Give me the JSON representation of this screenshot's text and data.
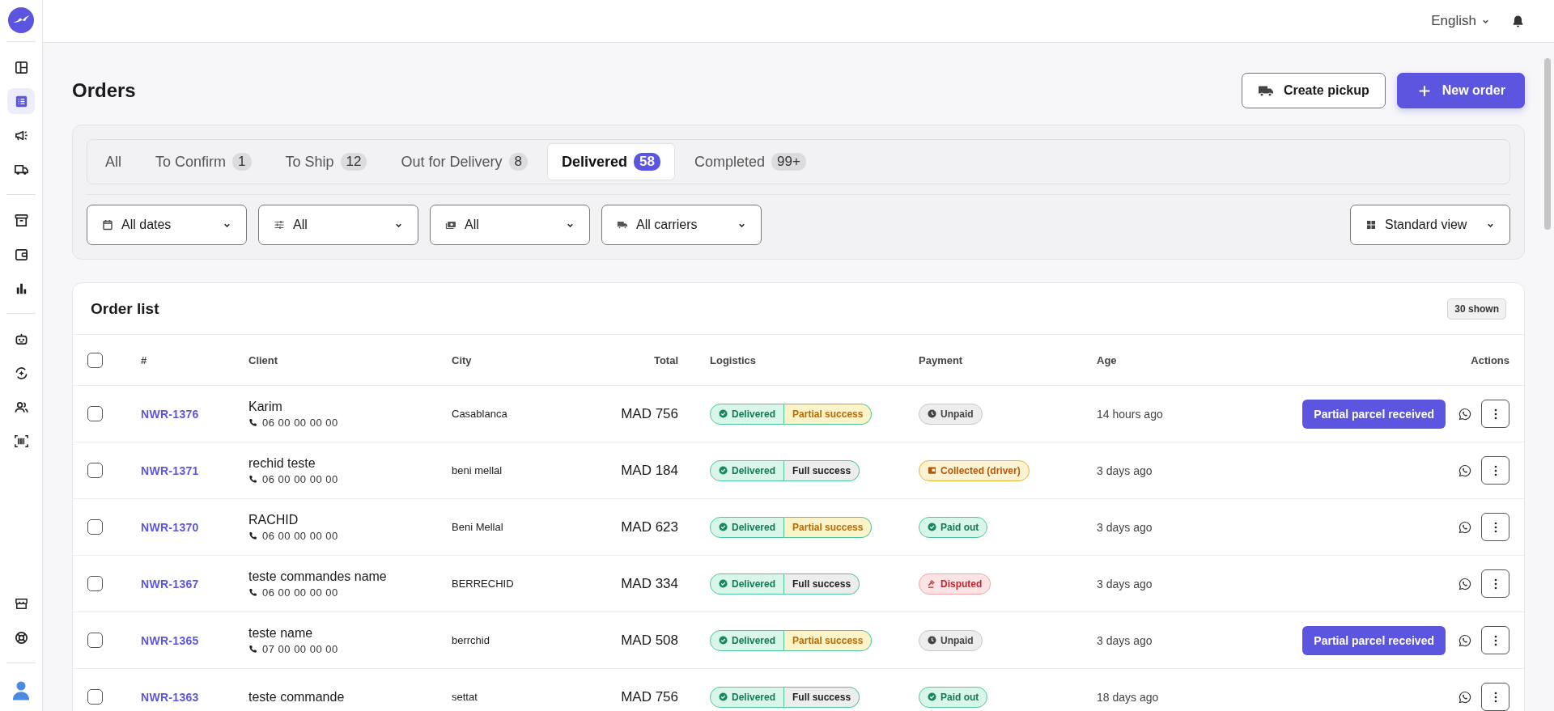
{
  "sidebar": {
    "groups": [
      {
        "items": [
          {
            "selected": false
          },
          {
            "selected": true
          },
          {
            "selected": false
          },
          {
            "selected": false
          }
        ]
      },
      {
        "items": [
          {
            "selected": false
          },
          {
            "selected": false
          },
          {
            "selected": false
          }
        ]
      },
      {
        "items": [
          {
            "selected": false
          },
          {
            "selected": false
          },
          {
            "selected": false
          },
          {
            "selected": false
          }
        ]
      }
    ],
    "bottom_items": [
      {
        "selected": false
      },
      {
        "selected": false
      }
    ]
  },
  "header": {
    "language": "English"
  },
  "page": {
    "title": "Orders",
    "buttons": [
      {
        "label": "Create pickup",
        "kind": "secondary"
      },
      {
        "label": "New order",
        "kind": "primary"
      }
    ]
  },
  "tabs": [
    {
      "label": "All",
      "selected": false
    },
    {
      "label": "To Confirm",
      "count": "1",
      "selected": false
    },
    {
      "label": "To Ship",
      "count": "12",
      "selected": false
    },
    {
      "label": "Out for Delivery",
      "count": "8",
      "selected": false
    },
    {
      "label": "Delivered",
      "count": "58",
      "selected": true
    },
    {
      "label": "Completed",
      "count": "99+",
      "selected": false
    }
  ],
  "filters": [
    {
      "label": "All dates",
      "kind": "date"
    },
    {
      "label": "All",
      "kind": "sliders"
    },
    {
      "label": "All",
      "kind": "money"
    },
    {
      "label": "All carriers",
      "kind": "truck"
    }
  ],
  "view_select": {
    "label": "Standard view"
  },
  "order_list": {
    "title": "Order list",
    "count_badge": "30 shown",
    "columns": [
      "#",
      "Client",
      "City",
      "Total",
      "Logistics",
      "Payment",
      "Age",
      "Actions"
    ],
    "select_all": {
      "checked": false
    },
    "rows": [
      {
        "selected": false,
        "id": "NWR-1376",
        "client": "Karim",
        "phone": "06 00 00 00 00",
        "city": "Casablanca",
        "total": "MAD 756",
        "logistics": "Delivered",
        "outcome": {
          "label": "Partial success",
          "kind": "partial"
        },
        "payment": {
          "label": "Unpaid",
          "kind": "unpaid"
        },
        "age": "14 hours ago",
        "action": "Partial parcel received"
      },
      {
        "selected": false,
        "id": "NWR-1371",
        "client": "rechid teste",
        "phone": "06 00 00 00 00",
        "city": "beni mellal",
        "total": "MAD 184",
        "logistics": "Delivered",
        "outcome": {
          "label": "Full success",
          "kind": "full"
        },
        "payment": {
          "label": "Collected (driver)",
          "kind": "collected"
        },
        "age": "3 days ago"
      },
      {
        "selected": false,
        "id": "NWR-1370",
        "client": "RACHID",
        "phone": "06 00 00 00 00",
        "city": "Beni Mellal",
        "total": "MAD 623",
        "logistics": "Delivered",
        "outcome": {
          "label": "Partial success",
          "kind": "partial"
        },
        "payment": {
          "label": "Paid out",
          "kind": "paid"
        },
        "age": "3 days ago"
      },
      {
        "selected": false,
        "id": "NWR-1367",
        "client": "teste commandes name",
        "phone": "06 00 00 00 00",
        "city": "BERRECHID",
        "total": "MAD 334",
        "logistics": "Delivered",
        "outcome": {
          "label": "Full success",
          "kind": "full"
        },
        "payment": {
          "label": "Disputed",
          "kind": "disputed"
        },
        "age": "3 days ago"
      },
      {
        "selected": false,
        "id": "NWR-1365",
        "client": "teste name",
        "phone": "07 00 00 00 00",
        "city": "berrchid",
        "total": "MAD 508",
        "logistics": "Delivered",
        "outcome": {
          "label": "Partial success",
          "kind": "partial"
        },
        "payment": {
          "label": "Unpaid",
          "kind": "unpaid"
        },
        "age": "3 days ago",
        "action": "Partial parcel received"
      },
      {
        "selected": false,
        "id": "NWR-1363",
        "client": "teste commande",
        "city": "settat",
        "total": "MAD 756",
        "logistics": "Delivered",
        "outcome": {
          "label": "Full success",
          "kind": "full"
        },
        "payment": {
          "label": "Paid out",
          "kind": "paid"
        },
        "age": "18 days ago"
      }
    ]
  }
}
